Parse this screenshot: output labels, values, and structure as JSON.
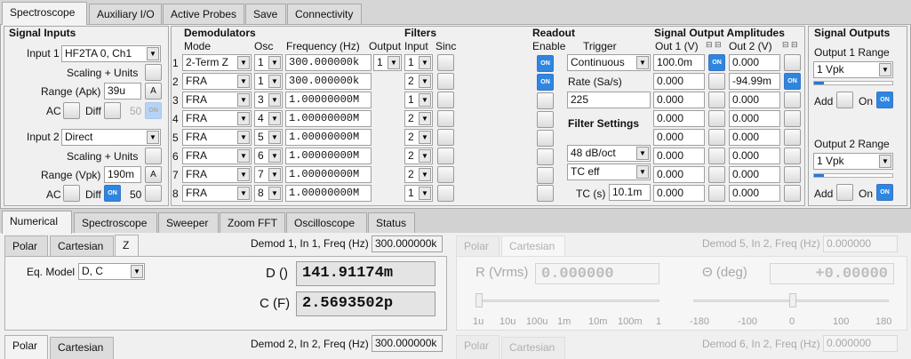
{
  "top_tabs": [
    "Spectroscope",
    "Auxiliary I/O",
    "Active Probes",
    "Save",
    "Connectivity"
  ],
  "signal_inputs": {
    "title": "Signal Inputs",
    "input1_label": "Input 1",
    "input1_value": "HF2TA 0, Ch1",
    "scaling1": "Scaling + Units",
    "range1_label": "Range (Apk)",
    "range1_value": "39u",
    "auto_label": "A",
    "ac_label": "AC",
    "diff_label": "Diff",
    "fifty_label": "50",
    "input2_label": "Input 2",
    "input2_value": "Direct",
    "scaling2": "Scaling + Units",
    "range2_label": "Range (Vpk)",
    "range2_value": "190m",
    "on_label": "ON"
  },
  "demodulators": {
    "title": "Demodulators",
    "filters_title": "Filters",
    "col_mode": "Mode",
    "col_osc": "Osc",
    "col_freq": "Frequency (Hz)",
    "col_output": "Output",
    "col_input": "Input",
    "col_sinc": "Sinc",
    "rows": [
      {
        "n": "1",
        "mode": "2-Term Z",
        "osc": "1",
        "freq": "300.000000k",
        "output": "1",
        "input": "1"
      },
      {
        "n": "2",
        "mode": "FRA",
        "osc": "1",
        "freq": "300.000000k",
        "output": "",
        "input": "2"
      },
      {
        "n": "3",
        "mode": "FRA",
        "osc": "3",
        "freq": "1.00000000M",
        "output": "",
        "input": "1"
      },
      {
        "n": "4",
        "mode": "FRA",
        "osc": "4",
        "freq": "1.00000000M",
        "output": "",
        "input": "2"
      },
      {
        "n": "5",
        "mode": "FRA",
        "osc": "5",
        "freq": "1.00000000M",
        "output": "",
        "input": "2"
      },
      {
        "n": "6",
        "mode": "FRA",
        "osc": "6",
        "freq": "1.00000000M",
        "output": "",
        "input": "2"
      },
      {
        "n": "7",
        "mode": "FRA",
        "osc": "7",
        "freq": "1.00000000M",
        "output": "",
        "input": "2"
      },
      {
        "n": "8",
        "mode": "FRA",
        "osc": "8",
        "freq": "1.00000000M",
        "output": "",
        "input": "1"
      }
    ]
  },
  "readout": {
    "title": "Readout",
    "enable": "Enable",
    "trigger": "Trigger",
    "trigger_value": "Continuous",
    "rate_label": "Rate (Sa/s)",
    "rate_value": "225",
    "filter_settings": "Filter Settings",
    "slope": "48 dB/oct",
    "tc_mode": "TC eff",
    "tc_label": "TC (s)",
    "tc_value": "10.1m"
  },
  "signal_output_amplitudes": {
    "title": "Signal Output Amplitudes",
    "out1": "Out 1 (V)",
    "out2": "Out 2 (V)",
    "out1_values": [
      "100.0m",
      "0.000",
      "0.000",
      "0.000",
      "0.000",
      "0.000",
      "0.000",
      "0.000"
    ],
    "out2_values": [
      "0.000",
      "-94.99m",
      "0.000",
      "0.000",
      "0.000",
      "0.000",
      "0.000",
      "0.000"
    ]
  },
  "signal_outputs": {
    "title": "Signal Outputs",
    "out1_range_label": "Output 1 Range",
    "out1_range": "1  Vpk",
    "out2_range_label": "Output 2 Range",
    "out2_range": "1  Vpk",
    "add_label": "Add",
    "on_text": "On",
    "out1_level": 0.12,
    "out2_level": 0.12
  },
  "bottom_tabs": [
    "Numerical",
    "Spectroscope",
    "Sweeper",
    "Zoom FFT",
    "Oscilloscope",
    "Status"
  ],
  "numerical": {
    "view_tabs": [
      "Polar",
      "Cartesian",
      "Z"
    ],
    "demod1_label": "Demod 1, In 1, Freq (Hz)",
    "demod1_freq": "300.000000k",
    "eq_model_label": "Eq. Model",
    "eq_model": "D, C",
    "d_label": "D ()",
    "d_value": "141.91174m",
    "c_label": "C (F)",
    "c_value": "2.5693502p",
    "demod2_label": "Demod 2, In 2, Freq (Hz)",
    "demod2_freq": "300.000000k",
    "view_tabs2": [
      "Polar",
      "Cartesian"
    ],
    "demod5_label": "Demod 5, In 2, Freq (Hz)",
    "demod5_freq": "0.000000",
    "r_label": "R (Vrms)",
    "r_value": "0.000000",
    "theta_label": "Θ (deg)",
    "theta_value": "+0.00000",
    "r_ticks": [
      "1u",
      "10u",
      "100u",
      "1m",
      "10m",
      "100m",
      "1"
    ],
    "theta_ticks": [
      "-180",
      "-100",
      "0",
      "100",
      "180"
    ],
    "demod6_label": "Demod 6, In 2, Freq (Hz)",
    "demod6_freq": "0.000000"
  }
}
